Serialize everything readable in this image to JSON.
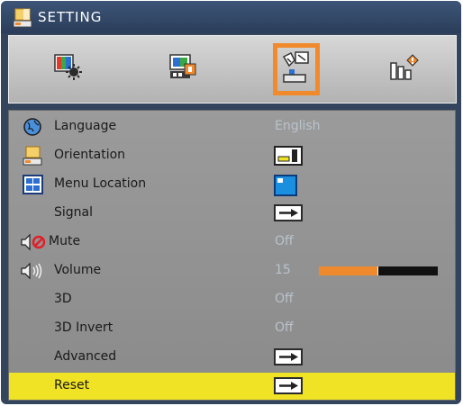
{
  "window": {
    "title": "SETTING",
    "title_icon": "projector-setting-icon"
  },
  "tabs": [
    {
      "name": "image-tab",
      "icon": "image-settings-icon",
      "selected": false
    },
    {
      "name": "display-tab",
      "icon": "display-settings-icon",
      "selected": false
    },
    {
      "name": "setting-tab",
      "icon": "setup-settings-icon",
      "selected": true
    },
    {
      "name": "options-tab",
      "icon": "options-settings-icon",
      "selected": false
    }
  ],
  "menu": {
    "language": {
      "label": "Language",
      "value": "English",
      "icon": "globe-icon"
    },
    "orientation": {
      "label": "Orientation",
      "icon": "projector-orientation-icon",
      "value_icon": "front-desktop-icon"
    },
    "menu_location": {
      "label": "Menu Location",
      "icon": "menu-location-icon",
      "value_icon": "top-left-position-icon"
    },
    "signal": {
      "label": "Signal",
      "value_icon": "arrow-right-icon"
    },
    "mute": {
      "label": "Mute",
      "value": "Off",
      "icon": "mute-speaker-icon"
    },
    "volume": {
      "label": "Volume",
      "value": "15",
      "icon": "speaker-icon",
      "level": 0.5
    },
    "three_d": {
      "label": "3D",
      "value": "Off"
    },
    "three_d_invert": {
      "label": "3D Invert",
      "value": "Off"
    },
    "advanced": {
      "label": "Advanced",
      "value_icon": "arrow-right-icon"
    },
    "reset": {
      "label": "Reset",
      "value_icon": "arrow-right-icon",
      "selected": true
    }
  },
  "colors": {
    "highlight": "#f0e224",
    "tab_selected_border": "#f08a2c",
    "volume_fill": "#ee8a2d",
    "value_text": "#b9c2cc"
  }
}
